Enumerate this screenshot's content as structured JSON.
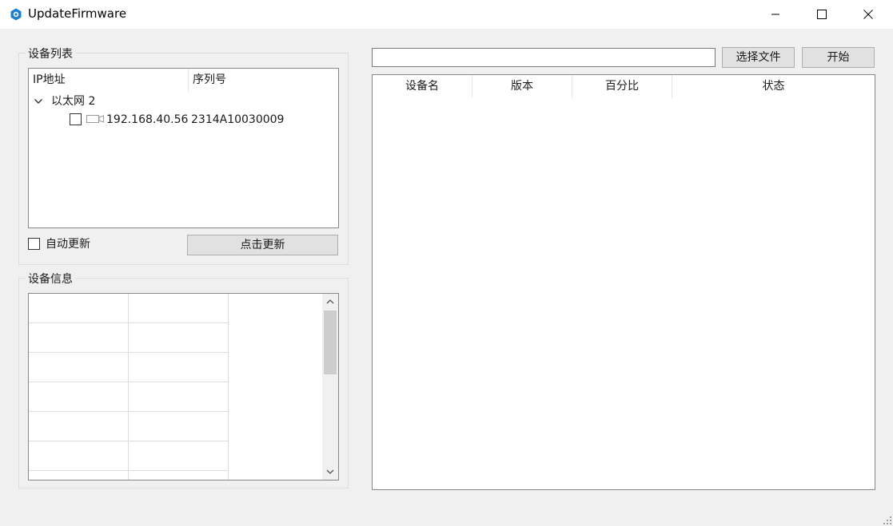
{
  "window": {
    "title": "UpdateFirmware",
    "icon": "app-gear-icon",
    "controls": [
      "minimize-icon",
      "maximize-icon",
      "close-icon"
    ]
  },
  "device_list": {
    "title": "设备列表",
    "columns": [
      "IP地址",
      "序列号"
    ],
    "groups": [
      {
        "label": "以太网 2",
        "expanded": true,
        "devices": [
          {
            "ip": "192.168.40.56",
            "serial": "2314A10030009",
            "checked": false,
            "icon": "camera-icon"
          }
        ]
      }
    ],
    "auto_update": {
      "label": "自动更新",
      "checked": false
    },
    "refresh_button": "点击更新"
  },
  "device_info": {
    "title": "设备信息",
    "visible_rows": 7,
    "columns": 2
  },
  "firmware": {
    "file_path": "",
    "choose_file_button": "选择文件",
    "start_button": "开始",
    "columns": [
      "设备名",
      "版本",
      "百分比",
      "状态"
    ],
    "rows": []
  },
  "colors": {
    "window_bg": "#f0f0f0",
    "titlebar_bg": "#ffffff",
    "app_icon": "#1e7fd0",
    "button_bg": "#e1e1e1"
  }
}
